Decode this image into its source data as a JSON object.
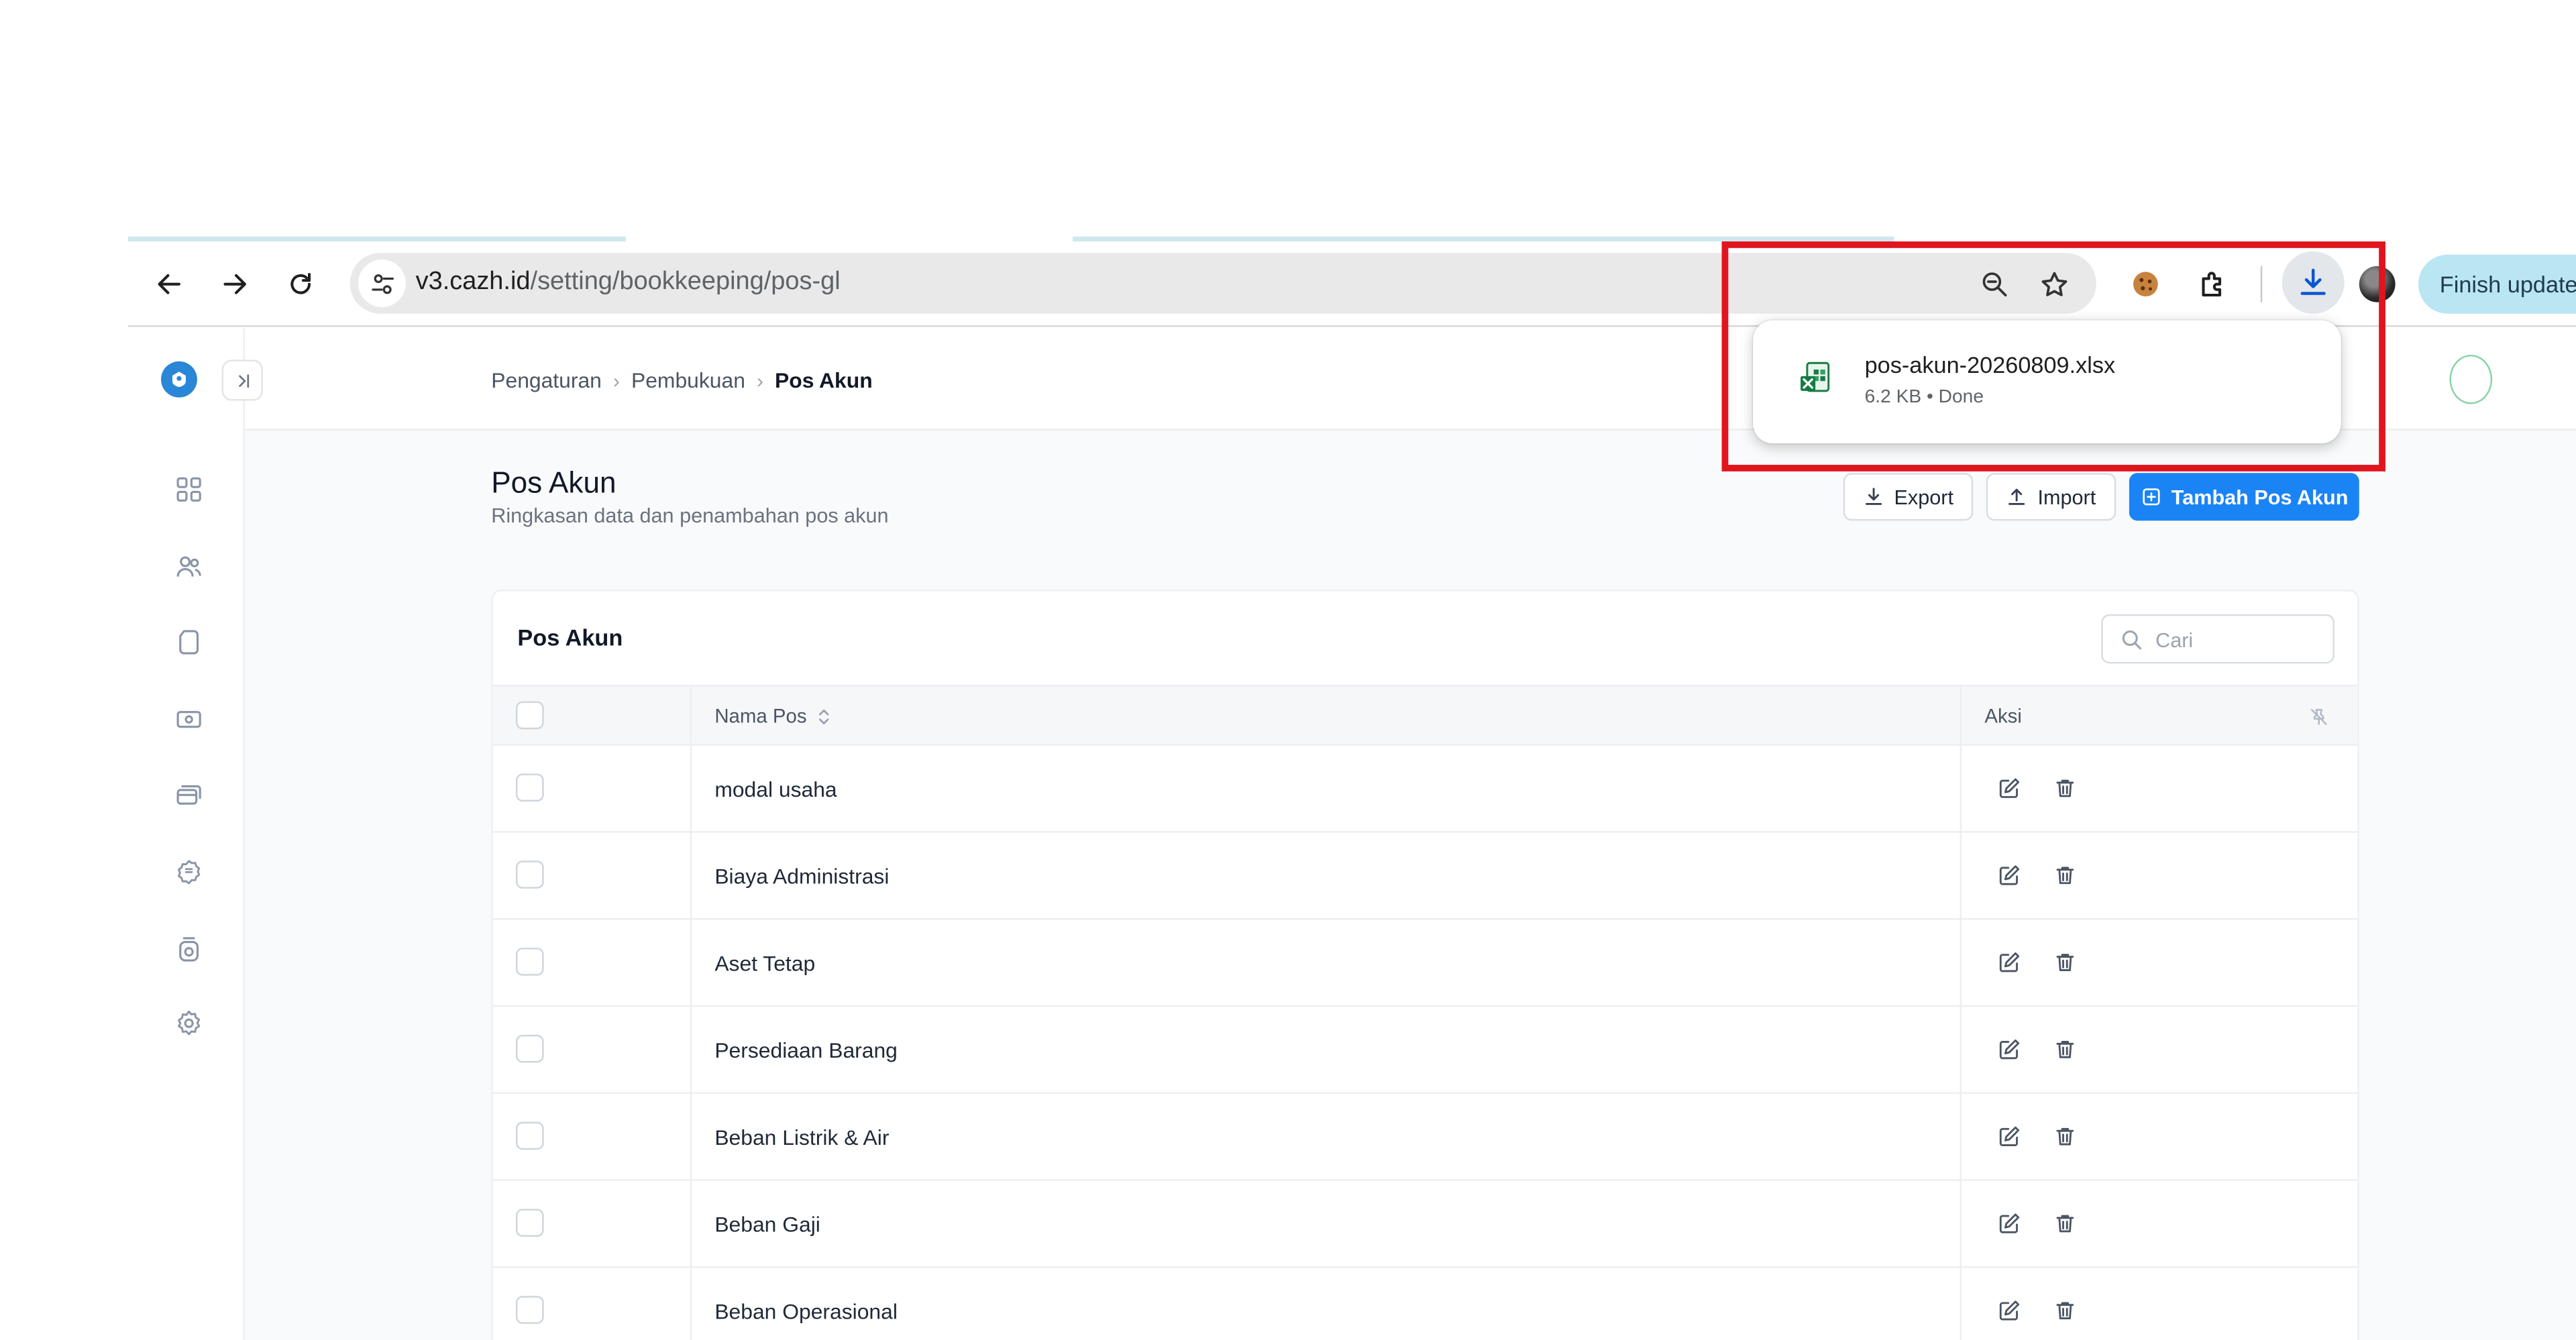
{
  "browser": {
    "url_host": "v3.cazh.id",
    "url_path": "/setting/bookkeeping/pos-gl",
    "finish_update_label": "Finish update",
    "download_bubble": {
      "file_name": "pos-akun-20260809.xlsx",
      "status": "6.2 KB • Done"
    }
  },
  "app": {
    "breadcrumbs": [
      "Pengaturan",
      "Pembukuan",
      "Pos Akun"
    ],
    "page_title": "Pos Akun",
    "page_subtitle": "Ringkasan data dan penambahan pos akun",
    "buttons": {
      "export": "Export",
      "import": "Import",
      "add": "Tambah Pos Akun"
    },
    "card": {
      "title": "Pos Akun",
      "search_placeholder": "Cari",
      "columns": [
        "Nama Pos",
        "Aksi"
      ],
      "rows": [
        {
          "name": "modal usaha"
        },
        {
          "name": "Biaya Administrasi"
        },
        {
          "name": "Aset Tetap"
        },
        {
          "name": "Persediaan Barang"
        },
        {
          "name": "Beban Listrik & Air"
        },
        {
          "name": "Beban Gaji"
        },
        {
          "name": "Beban Operasional"
        }
      ]
    },
    "sidebar_icons": [
      "dashboard-icon",
      "users-icon",
      "document-icon",
      "cash-icon",
      "cards-icon",
      "badge-icon",
      "savings-icon",
      "settings-icon"
    ]
  },
  "colors": {
    "primary": "#1b84f5",
    "highlight": "#e0151e",
    "finish_update_bg": "#b9e6f2"
  }
}
